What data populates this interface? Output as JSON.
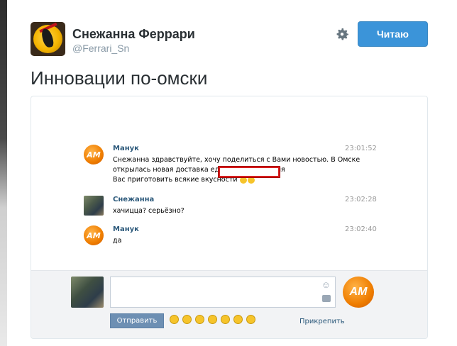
{
  "profile": {
    "name": "Снежанна Феррари",
    "handle": "@Ferrari_Sn",
    "follow_label": "Читаю",
    "icons": [
      "ferrari-logo-avatar",
      "gear-icon"
    ]
  },
  "tweet": {
    "text": "Инновации по-омски"
  },
  "chat": {
    "messages": [
      {
        "author": "Манук",
        "time": "23:01:52",
        "lines": [
          "Снежанна здравствуйте, хочу поделиться с Вами новостью. В Омске",
          "открылась новая доставка еды                              Будем рады для",
          "Вас приготовить всякие вкусности"
        ]
      },
      {
        "author": "Снежанна",
        "time": "23:02:28",
        "lines": [
          "хачицца? серьёзно?"
        ]
      },
      {
        "author": "Манук",
        "time": "23:02:40",
        "lines": [
          "да"
        ]
      }
    ],
    "avatar_text": "AM",
    "send_label": "Отправить",
    "attach_label": "Прикрепить",
    "colors": {
      "link": "#2b587a",
      "button": "#6d8fb3",
      "redaction": "#d61f1f"
    }
  }
}
